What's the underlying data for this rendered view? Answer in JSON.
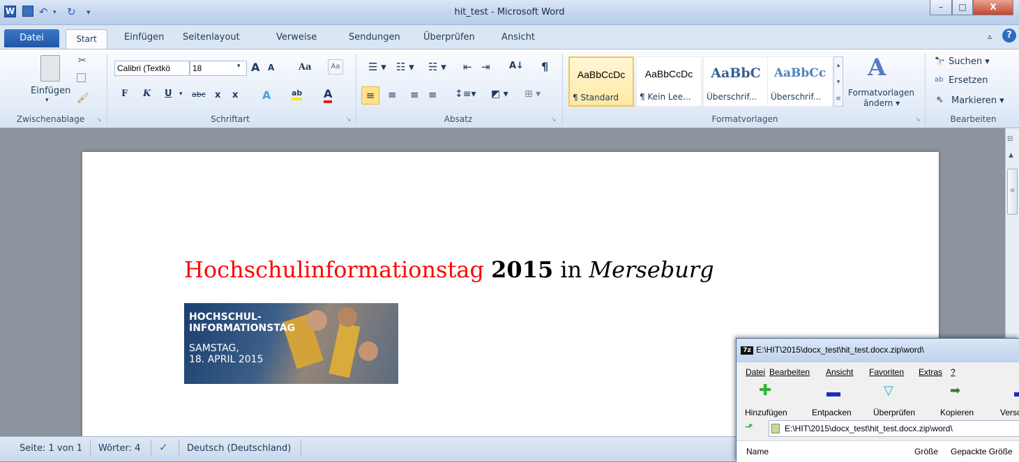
{
  "window": {
    "title": "hit_test - Microsoft Word",
    "minimize": "–",
    "maximize": "□",
    "close": "X"
  },
  "quick_access": {
    "undo": "↶",
    "redo": "↻",
    "menu": "▾"
  },
  "tabs": {
    "file": "Datei",
    "start": "Start",
    "items": [
      "Einfügen",
      "Seitenlayout",
      "Verweise",
      "Sendungen",
      "Überprüfen",
      "Ansicht"
    ]
  },
  "ribbon": {
    "clipboard": {
      "paste": "Einfügen",
      "group": "Zwischenablage"
    },
    "font": {
      "name": "Calibri (Textkö",
      "size": "18",
      "grow": "A",
      "shrink": "A",
      "case": "Aa",
      "bold": "F",
      "italic": "K",
      "underline": "U",
      "strike": "abc",
      "sub": "x",
      "sup": "x",
      "effects": "A",
      "highlight": "ab",
      "color": "A",
      "group": "Schriftart"
    },
    "paragraph": {
      "sort": "A↓",
      "pilcrow": "¶",
      "group": "Absatz"
    },
    "styles": {
      "items": [
        {
          "sample": "AaBbCcDc",
          "label": "¶ Standard"
        },
        {
          "sample": "AaBbCcDc",
          "label": "¶ Kein Lee..."
        },
        {
          "sample": "AaBbC",
          "label": "Überschrif..."
        },
        {
          "sample": "AaBbCc",
          "label": "Überschrif..."
        }
      ],
      "change_label_1": "Formatvorlagen",
      "change_label_2": "ändern ▾",
      "group": "Formatvorlagen"
    },
    "editing": {
      "find": "Suchen ▾",
      "replace": "Ersetzen",
      "select": "Markieren ▾",
      "group": "Bearbeiten"
    }
  },
  "document": {
    "heading_part1": "Hochschulinformationstag",
    "heading_part2": "2015",
    "heading_part3": "in",
    "heading_part4": "Merseburg",
    "heading_color": "#ff0000",
    "banner": {
      "line1": "HOCHSCHUL-",
      "line2": "INFORMATIONSTAG",
      "line3": "SAMSTAG,",
      "line4": "18. APRIL 2015"
    }
  },
  "status": {
    "page": "Seite: 1 von 1",
    "words": "Wörter: 4",
    "language": "Deutsch (Deutschland)"
  },
  "sevenzip": {
    "title": "E:\\HIT\\2015\\docx_test\\hit_test.docx.zip\\word\\",
    "menu": [
      "Datei",
      "Bearbeiten",
      "Ansicht",
      "Favoriten",
      "Extras",
      "?"
    ],
    "toolbar": [
      "Hinzufügen",
      "Entpacken",
      "Überprüfen",
      "Kopieren",
      "Versch"
    ],
    "path": "E:\\HIT\\2015\\docx_test\\hit_test.docx.zip\\word\\",
    "columns": [
      "Name",
      "Größe",
      "Gepackte Größe"
    ]
  }
}
